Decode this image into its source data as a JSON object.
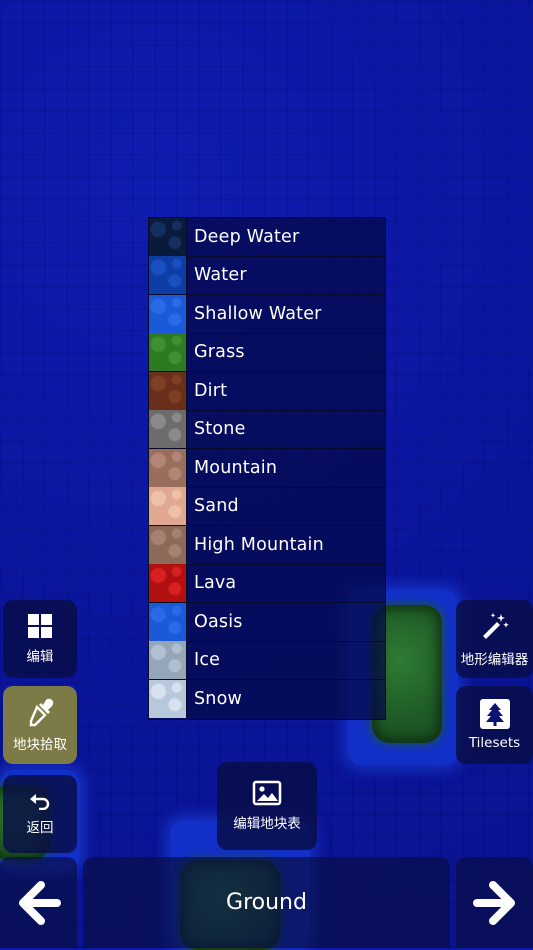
{
  "tiles": [
    {
      "name": "Deep Water",
      "color": "#0a1a3a",
      "texture": "#153060"
    },
    {
      "name": "Water",
      "color": "#0d3ea8",
      "texture": "#1a4fc0"
    },
    {
      "name": "Shallow Water",
      "color": "#1a5ad8",
      "texture": "#2a6ae6"
    },
    {
      "name": "Grass",
      "color": "#2e7a22",
      "texture": "#3f9030"
    },
    {
      "name": "Dirt",
      "color": "#6a2f1a",
      "texture": "#7f3f24"
    },
    {
      "name": "Stone",
      "color": "#6c6c6c",
      "texture": "#8a8a8a"
    },
    {
      "name": "Mountain",
      "color": "#9a6e5c",
      "texture": "#b28674"
    },
    {
      "name": "Sand",
      "color": "#e0a890",
      "texture": "#eec0a8"
    },
    {
      "name": "High Mountain",
      "color": "#8c6a58",
      "texture": "#a68070"
    },
    {
      "name": "Lava",
      "color": "#b01010",
      "texture": "#d82020"
    },
    {
      "name": "Oasis",
      "color": "#1a5ad8",
      "texture": "#2a6ae6"
    },
    {
      "name": "Ice",
      "color": "#94a6b8",
      "texture": "#b0c0d0"
    },
    {
      "name": "Snow",
      "color": "#b8c8dc",
      "texture": "#d8e2ee"
    }
  ],
  "left_panel": {
    "edit_label": "编辑",
    "pick_label": "地块拾取",
    "back_label": "返回"
  },
  "right_panel": {
    "terrain_editor_label": "地形编辑器",
    "tilesets_label": "Tilesets"
  },
  "center": {
    "edit_tileset_label": "编辑地块表"
  },
  "bottom": {
    "layer_label": "Ground"
  },
  "colors": {
    "sea": "#0c18a6",
    "panel": "#080e46",
    "active_panel": "#7c7a46"
  },
  "icons": {
    "edit": "grid-icon",
    "pick": "eyedropper-icon",
    "back": "undo-icon",
    "terrain": "magic-wand-icon",
    "tilesets": "tree-icon",
    "edit_tileset": "image-icon",
    "prev": "arrow-left-icon",
    "next": "arrow-right-icon"
  }
}
